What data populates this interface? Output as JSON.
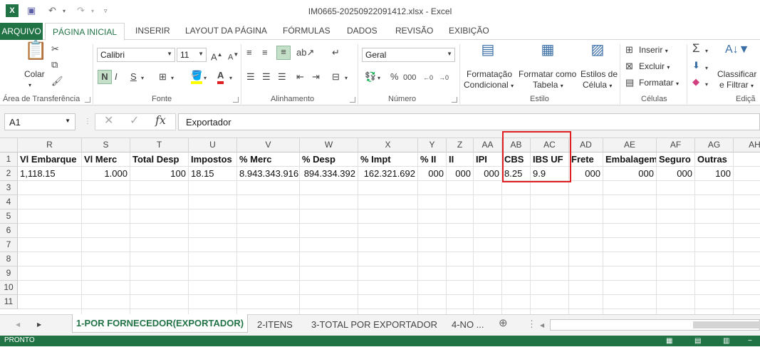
{
  "window": {
    "title": "IM0665-20250922091412.xlsx - Excel"
  },
  "tabs": {
    "file": "ARQUIVO",
    "home": "PÁGINA INICIAL",
    "insert": "INSERIR",
    "layout": "LAYOUT DA PÁGINA",
    "formulas": "FÓRMULAS",
    "data": "DADOS",
    "review": "REVISÃO",
    "view": "EXIBIÇÃO"
  },
  "ribbon": {
    "paste": "Colar",
    "clipboard_group": "Área de Transferência",
    "font_name": "Calibri",
    "font_size": "11",
    "bold": "N",
    "italic": "I",
    "underline": "S",
    "font_group": "Fonte",
    "align_group": "Alinhamento",
    "number_format": "Geral",
    "percent": "%",
    "thousands": "000",
    "number_group": "Número",
    "cond_format_1": "Formatação",
    "cond_format_2": "Condicional",
    "table_format_1": "Formatar como",
    "table_format_2": "Tabela",
    "cell_styles_1": "Estilos de",
    "cell_styles_2": "Célula",
    "style_group": "Estilo",
    "insert": "Inserir",
    "delete": "Excluir",
    "format": "Formatar",
    "cells_group": "Células",
    "sort_1": "Classificar",
    "sort_2": "e Filtrar",
    "edit_group": "Ediçã"
  },
  "formula_bar": {
    "name_box": "A1",
    "fx": "fx",
    "content": "Exportador"
  },
  "columns": [
    "R",
    "S",
    "T",
    "U",
    "V",
    "W",
    "X",
    "Y",
    "Z",
    "AA",
    "AB",
    "AC",
    "AD",
    "AE",
    "AF",
    "AG",
    "AH"
  ],
  "rows": [
    "1",
    "2",
    "3",
    "4",
    "5",
    "6",
    "7",
    "8",
    "9",
    "10",
    "11"
  ],
  "row1": [
    "Vl Embarque",
    "Vl Merc",
    "Total Desp",
    "Impostos",
    "% Merc",
    "% Desp",
    "% Impt",
    "% II",
    "II",
    "IPI",
    "CBS",
    "IBS UF",
    "Frete",
    "Embalagem",
    "Seguro",
    "Outras",
    ""
  ],
  "row2": [
    "1,118.15",
    "1.000",
    "100",
    "18.15",
    "8.943.343.916",
    "894.334.392",
    "162.321.692",
    "000",
    "000",
    "000",
    "8.25",
    "9.9",
    "000",
    "000",
    "000",
    "100",
    ""
  ],
  "sheets": [
    "1-POR FORNECEDOR(EXPORTADOR)",
    "2-ITENS",
    "3-TOTAL POR EXPORTADOR",
    "4-NO ..."
  ],
  "status": {
    "text": "PRONTO"
  },
  "colors": {
    "accent": "#217346",
    "highlight_box": "#e02020"
  }
}
